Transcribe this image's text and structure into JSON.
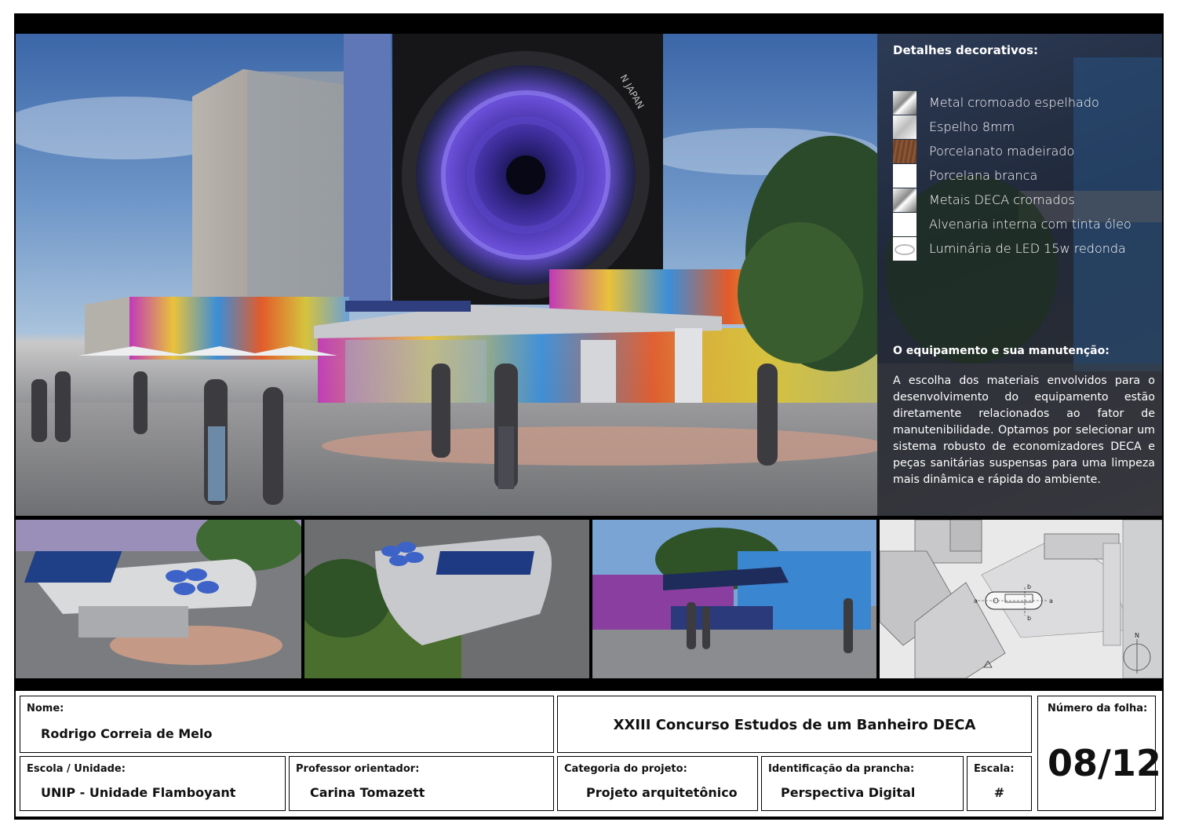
{
  "panel": {
    "decor_title": "Detalhes decorativos:",
    "legend": [
      {
        "label": "Metal cromoado espelhado",
        "swatch": "chrome"
      },
      {
        "label": "Espelho 8mm",
        "swatch": "mirror"
      },
      {
        "label": "Porcelanato madeirado",
        "swatch": "wood"
      },
      {
        "label": "Porcelana branca",
        "swatch": "white"
      },
      {
        "label": "Metais DECA cromados",
        "swatch": "chrome"
      },
      {
        "label": "Alvenaria interna com tinta óleo",
        "swatch": "white"
      },
      {
        "label": "Luminária de LED 15w redonda",
        "swatch": "led"
      }
    ],
    "maint_title": "O equipamento e sua manutenção:",
    "maint_text": "A escolha dos materiais envolvidos para o desenvolvimento do equipamento estão diretamente relacionados ao fator de manutenibilidade. Optamos por selecionar um sistema robusto de economizadores DECA e peças sanitárias suspensas para uma limpeza mais dinâmica e rápida do ambiente."
  },
  "hero": {
    "camera_text": "N JAPAN"
  },
  "plan": {
    "section_marks": [
      "a",
      "a",
      "b",
      "b"
    ],
    "north": "N"
  },
  "titleblock": {
    "nome_label": "Nome:",
    "nome_value": "Rodrigo Correia de Melo",
    "contest": "XXIII Concurso Estudos de um Banheiro DECA",
    "folha_label": "Número da folha:",
    "folha_value": "08/12",
    "escola_label": "Escola / Unidade:",
    "escola_value": "UNIP - Unidade Flamboyant",
    "prof_label": "Professor orientador:",
    "prof_value": "Carina Tomazett",
    "categoria_label": "Categoria do projeto:",
    "categoria_value": "Projeto arquitetônico",
    "ident_label": "Identificação da prancha:",
    "ident_value": "Perspectiva Digital",
    "escala_label": "Escala:",
    "escala_value": "#"
  },
  "colors": {
    "sheet": "#000000",
    "wood": "#7a4a2c",
    "text_panel": "#ffffff"
  }
}
